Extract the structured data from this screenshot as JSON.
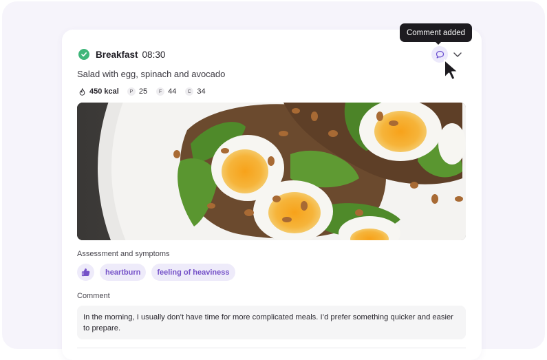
{
  "meal": {
    "name": "Breakfast",
    "time": "08:30",
    "description": "Salad with egg, spinach and avocado"
  },
  "nutrition": {
    "kcal": "450 kcal",
    "protein_letter": "P",
    "protein": "25",
    "fat_letter": "F",
    "fat": "44",
    "carbs_letter": "C",
    "carbs": "34"
  },
  "tooltip": "Comment added",
  "assessment": {
    "label": "Assessment and symptoms",
    "tags": [
      "heartburn",
      "feeling of heaviness"
    ]
  },
  "comment": {
    "label": "Comment",
    "text": "In the morning, I usually don’t have time for more complicated meals. I’d prefer something quicker and easier to prepare."
  },
  "icons": {
    "status": "check-circle-icon",
    "comment": "speech-bubble-icon",
    "expand": "chevron-down-icon",
    "kcal": "flame-icon",
    "rating": "thumbs-up-icon",
    "cursor": "mouse-pointer-icon"
  },
  "colors": {
    "check_green": "#3fb67a",
    "accent_purple": "#7552c8",
    "tag_bg": "#eeebfa",
    "tooltip_bg": "#1d1b20"
  }
}
